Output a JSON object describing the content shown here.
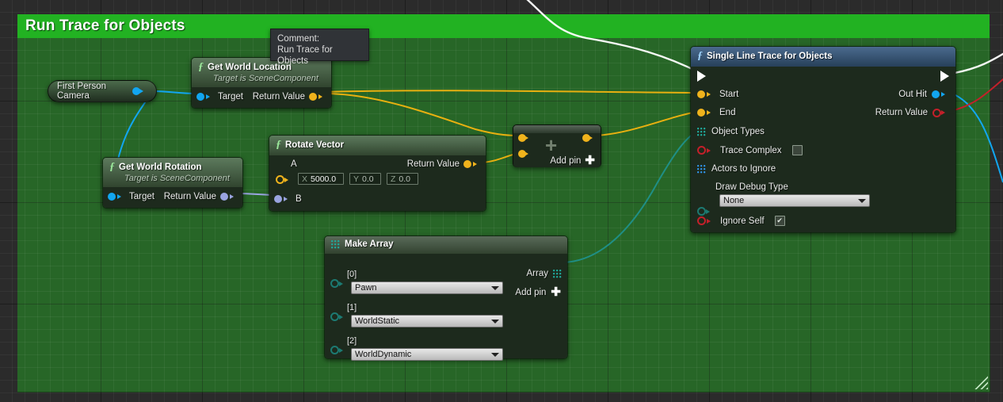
{
  "comment": {
    "title": "Run Trace for Objects",
    "tooltip_label": "Comment:",
    "tooltip_value": "Run Trace for Objects",
    "color": "#22b222"
  },
  "nodes": {
    "camera": {
      "label": "First Person Camera",
      "out_pin": "object-pin"
    },
    "get_world_location": {
      "title": "Get World Location",
      "subtitle": "Target is SceneComponent",
      "input": "Target",
      "output": "Return Value"
    },
    "get_world_rotation": {
      "title": "Get World Rotation",
      "subtitle": "Target is SceneComponent",
      "input": "Target",
      "output": "Return Value"
    },
    "rotate_vector": {
      "title": "Rotate Vector",
      "input_a": "A",
      "input_b": "B",
      "output": "Return Value",
      "vector": {
        "x_axis": "X",
        "x_value": "5000.0",
        "y_axis": "Y",
        "y_value": "0.0",
        "z_axis": "Z",
        "z_value": "0.0"
      }
    },
    "add": {
      "add_pin_label": "Add pin",
      "plus_glyph": "+"
    },
    "make_array": {
      "title": "Make Array",
      "output": "Array",
      "add_pin_label": "Add pin",
      "entries": [
        {
          "index": "[0]",
          "value": "Pawn"
        },
        {
          "index": "[1]",
          "value": "WorldStatic"
        },
        {
          "index": "[2]",
          "value": "WorldDynamic"
        }
      ]
    },
    "single_line_trace": {
      "title": "Single Line Trace for Objects",
      "inputs": {
        "start": "Start",
        "end": "End",
        "object_types": "Object Types",
        "trace_complex": "Trace Complex",
        "actors_to_ignore": "Actors to Ignore",
        "draw_debug_type_label": "Draw Debug Type",
        "draw_debug_type_value": "None",
        "ignore_self": "Ignore Self"
      },
      "outputs": {
        "out_hit": "Out Hit",
        "return_value": "Return Value"
      },
      "trace_complex_checked": "",
      "ignore_self_checked": "✔"
    }
  },
  "colors": {
    "exec_wire": "#ffffff",
    "vector_wire": "#e8b010",
    "object_wire": "#12a6f0",
    "rotator_wire": "#9aa4e0",
    "array_wire": "#1f8f86",
    "bool_wire": "#c4202a",
    "comment_green": "#22b222"
  }
}
